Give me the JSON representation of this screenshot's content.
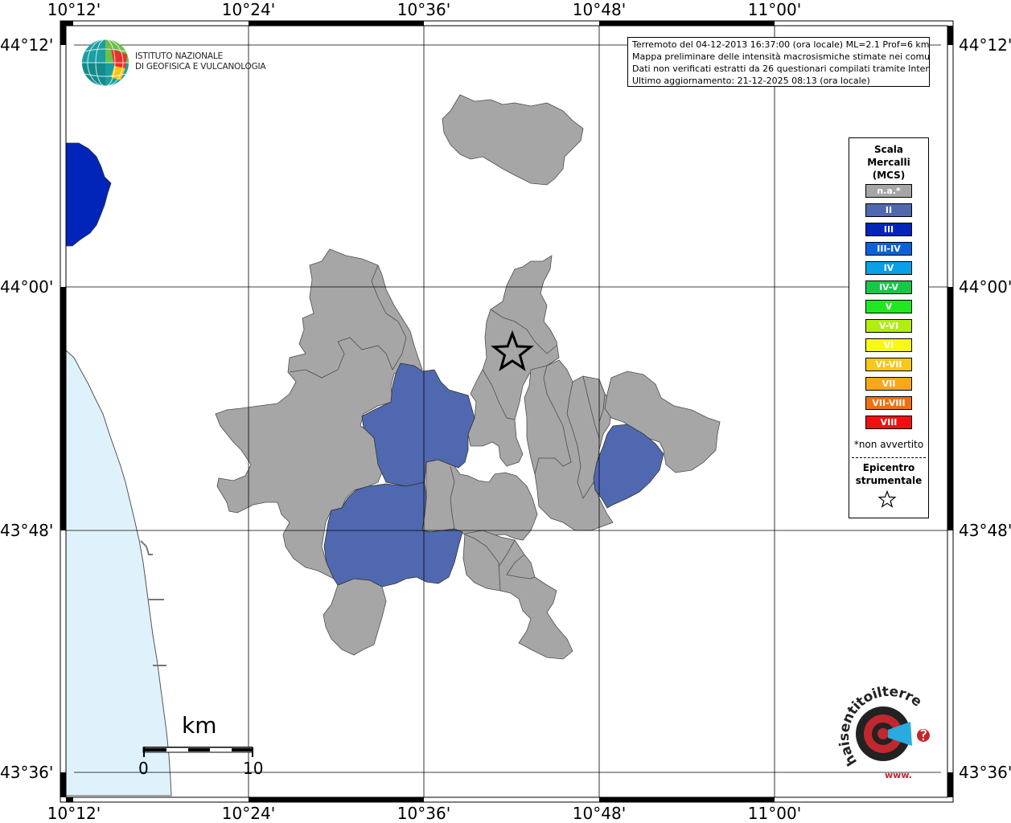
{
  "coordinates": {
    "top": [
      "10°12'",
      "10°24'",
      "10°36'",
      "10°48'",
      "11°00'"
    ],
    "bottom": [
      "10°12'",
      "10°24'",
      "10°36'",
      "10°48'",
      "11°00'"
    ],
    "left": [
      "44°12'",
      "44°00'",
      "43°48'",
      "43°36'"
    ],
    "right": [
      "44°12'",
      "44°00'",
      "43°48'",
      "43°36'"
    ]
  },
  "info": {
    "line1": "Terremoto del 04-12-2013 16:37:00 (ora locale) ML=2.1 Prof=6 km",
    "line2": "Mappa preliminare delle intensità macrosismiche stimate nei comuni",
    "line3": "Dati non verificati estratti da 26 questionari compilati tramite Internet.",
    "line4": "Ultimo aggiornamento: 21-12-2025 08:13 (ora locale)"
  },
  "logo": {
    "line1": "ISTITUTO NAZIONALE",
    "line2": "DI GEOFISICA E VULCANOLOGIA"
  },
  "legend": {
    "title1": "Scala",
    "title2": "Mercalli",
    "title3": "(MCS)",
    "items": [
      {
        "label": "n.a.*",
        "color": "#a6a6a6"
      },
      {
        "label": "II",
        "color": "#5068b0"
      },
      {
        "label": "III",
        "color": "#0025b8"
      },
      {
        "label": "III-IV",
        "color": "#0a62d6"
      },
      {
        "label": "IV",
        "color": "#08a0e6"
      },
      {
        "label": "IV-V",
        "color": "#16c848"
      },
      {
        "label": "V",
        "color": "#20e820"
      },
      {
        "label": "V-VI",
        "color": "#b0ee10"
      },
      {
        "label": "VI",
        "color": "#f8f818"
      },
      {
        "label": "VI-VII",
        "color": "#f8c818"
      },
      {
        "label": "VII",
        "color": "#f8a818"
      },
      {
        "label": "VII-VIII",
        "color": "#f07010"
      },
      {
        "label": "VIII",
        "color": "#f01010"
      }
    ],
    "note": "*non avvertito",
    "epicenter1": "Epicentro",
    "epicenter2": "strumentale"
  },
  "scale_bar": {
    "unit": "km",
    "start": "0",
    "end": "10"
  },
  "haisentito": {
    "text": "haisentitoilterremoto.it",
    "url": "www."
  },
  "colors": {
    "not_felt": "#a6a6a6",
    "intensity_ii": "#5068b0",
    "intensity_iii": "#0025b8",
    "sea": "#dff2fb"
  }
}
